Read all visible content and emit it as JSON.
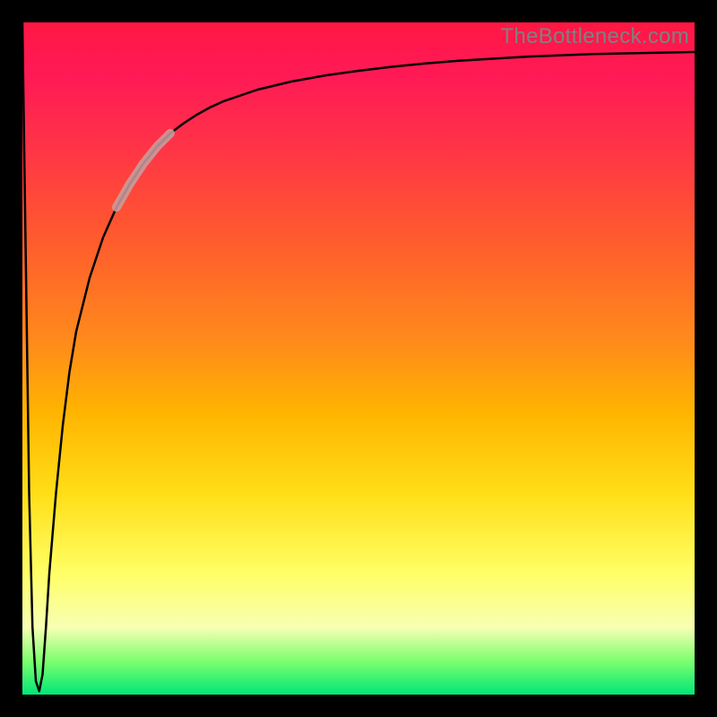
{
  "watermark": "TheBottleneck.com",
  "colors": {
    "frame": "#000000",
    "curve": "#000000",
    "highlight": "#c8a0a0",
    "gradient_top": "#ff1744",
    "gradient_bottom": "#00e676"
  },
  "chart_data": {
    "type": "line",
    "title": "",
    "xlabel": "",
    "ylabel": "",
    "xlim": [
      0,
      100
    ],
    "ylim": [
      0,
      100
    ],
    "x": [
      0,
      0.5,
      1,
      1.5,
      2,
      2.5,
      3,
      3.5,
      4,
      5,
      6,
      7,
      8,
      10,
      12,
      14,
      16,
      18,
      20,
      22,
      24,
      26,
      28,
      30,
      35,
      40,
      45,
      50,
      55,
      60,
      65,
      70,
      75,
      80,
      85,
      90,
      95,
      100
    ],
    "values": [
      100,
      65,
      30,
      10,
      2,
      0.5,
      3,
      10,
      18,
      30,
      40,
      48,
      54,
      62,
      68,
      72.5,
      76,
      79,
      81.5,
      83.5,
      85,
      86.3,
      87.4,
      88.3,
      90,
      91.2,
      92.1,
      92.8,
      93.4,
      93.9,
      94.3,
      94.6,
      94.9,
      95.1,
      95.3,
      95.4,
      95.5,
      95.6
    ],
    "highlight_range_x": [
      14,
      22
    ],
    "annotations": []
  }
}
